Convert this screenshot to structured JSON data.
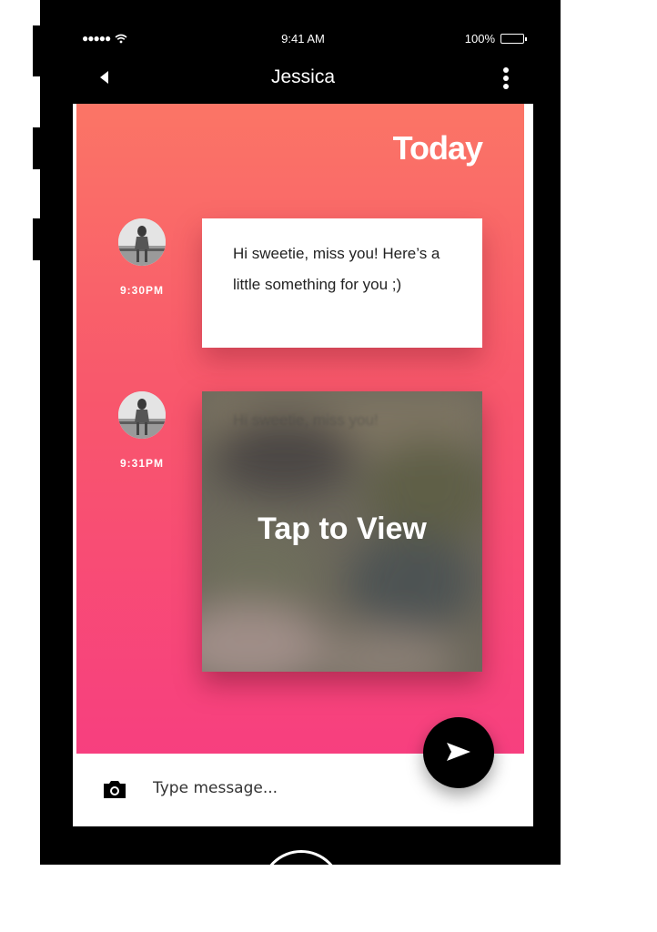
{
  "status_bar": {
    "signal": "●●●●●",
    "time": "9:41 AM",
    "battery_percent": "100%",
    "battery_level": 1.0
  },
  "nav": {
    "title": "Jessica",
    "back_icon": "back-arrow-icon",
    "menu_icon": "more-vertical-icon"
  },
  "chat": {
    "date_header": "Today",
    "messages": [
      {
        "type": "text",
        "time": "9:30PM",
        "text": "Hi sweetie, miss you! Here’s a little something for you ;)"
      },
      {
        "type": "media",
        "time": "9:31PM",
        "hidden_preview": "Hi sweetie, miss you!",
        "action_label": "Tap to View"
      }
    ]
  },
  "compose": {
    "placeholder": "Type message...",
    "value": "",
    "camera_icon": "camera-icon",
    "send_icon": "send-icon"
  },
  "colors": {
    "gradient_top": "#fb7566",
    "gradient_bottom": "#f73f7f",
    "bars": "#000000"
  }
}
